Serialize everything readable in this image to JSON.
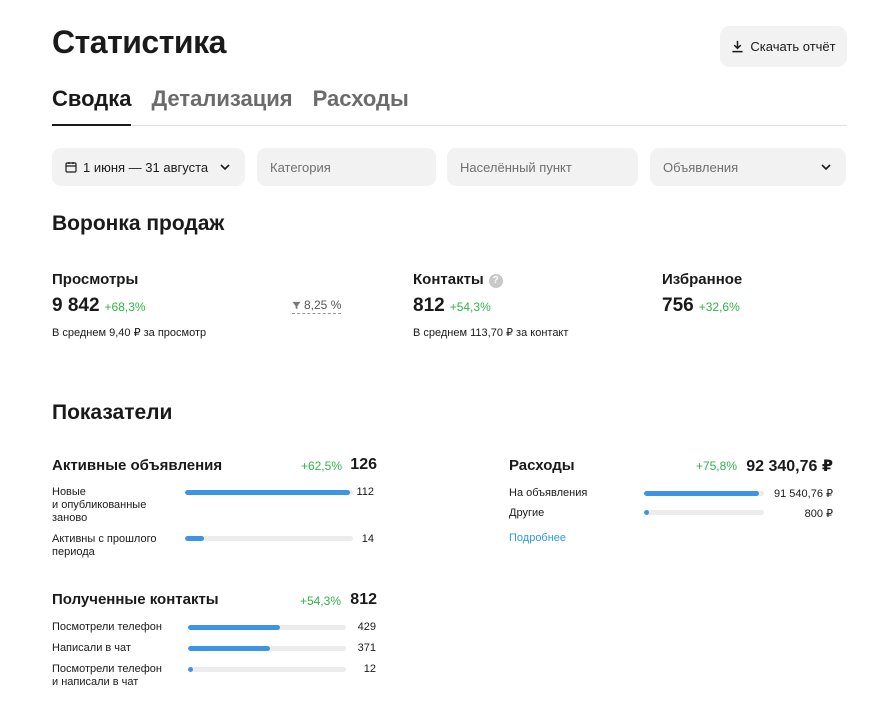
{
  "header": {
    "title": "Статистика",
    "download_label": "Скачать отчёт"
  },
  "tabs": [
    {
      "label": "Сводка",
      "active": true
    },
    {
      "label": "Детализация",
      "active": false
    },
    {
      "label": "Расходы",
      "active": false
    }
  ],
  "filters": {
    "date_range": "1 июня — 31 августа",
    "category_placeholder": "Категория",
    "locality_placeholder": "Населённый пункт",
    "listings_placeholder": "Объявления"
  },
  "funnel": {
    "title": "Воронка продаж",
    "views": {
      "label": "Просмотры",
      "value": "9 842",
      "delta": "+68,3%",
      "sub": "В среднем 9,40 ₽ за просмотр"
    },
    "conversion": "8,25 %",
    "contacts": {
      "label": "Контакты",
      "value": "812",
      "delta": "+54,3%",
      "sub": "В среднем 113,70 ₽ за контакт",
      "help": "?"
    },
    "favorites": {
      "label": "Избранное",
      "value": "756",
      "delta": "+32,6%"
    }
  },
  "metrics": {
    "title": "Показатели",
    "active_listings": {
      "title": "Активные объявления",
      "delta": "+62,5%",
      "total": "126",
      "rows": [
        {
          "label": "Новые\nи опубликованные\nзаново",
          "value": "112",
          "fraction": 0.985
        },
        {
          "label": "Активны с прошлого\nпериода",
          "value": "14",
          "fraction": 0.115
        }
      ]
    },
    "contacts": {
      "title": "Полученные контакты",
      "delta": "+54,3%",
      "total": "812",
      "rows": [
        {
          "label": "Посмотрели телефон",
          "value": "429",
          "fraction": 0.58
        },
        {
          "label": "Написали в чат",
          "value": "371",
          "fraction": 0.52
        },
        {
          "label": "Посмотрели телефон\nи написали в чат",
          "value": "12",
          "fraction": 0.03
        }
      ]
    },
    "expenses": {
      "title": "Расходы",
      "delta": "+75,8%",
      "total": "92 340,76 ₽",
      "rows": [
        {
          "label": "На объявления",
          "value": "91 540,76 ₽",
          "fraction": 0.955
        },
        {
          "label": "Другие",
          "value": "800 ₽",
          "fraction": 0.04
        }
      ],
      "more_label": "Подробнее"
    }
  },
  "colors": {
    "accent": "#3d93e6",
    "positive": "#2fb34a",
    "link": "#2e9ae5",
    "input_bg": "#f2f2f2"
  }
}
